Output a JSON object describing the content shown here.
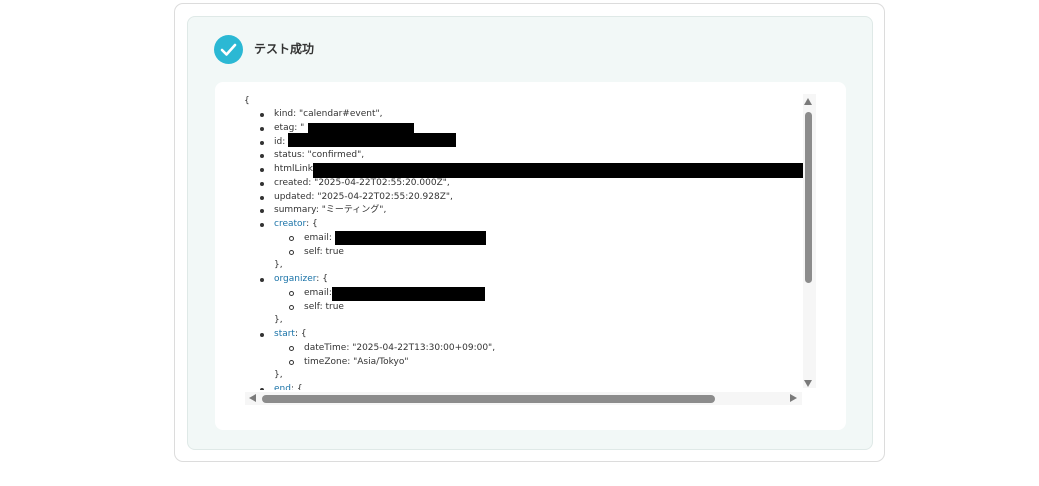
{
  "header": {
    "status_title": "テスト成功",
    "status_icon": "check-circle-icon",
    "accent_color": "#2bb8d4"
  },
  "json_view": {
    "open_brace": "{",
    "lines": {
      "kind": "kind: \"calendar#event\",",
      "etag": "etag: \"",
      "id": "id:",
      "status": "status: \"confirmed\",",
      "htmllink": "htmlLink",
      "created": "created: \"2025-04-22T02:55:20.000Z\",",
      "updated": "updated: \"2025-04-22T02:55:20.928Z\",",
      "summary": "summary: \"ミーティング\",",
      "creator_key": "creator",
      "creator_open": ": {",
      "creator_email": "email:",
      "creator_self": "self: true",
      "creator_close": "},",
      "organizer_key": "organizer",
      "organizer_open": ": {",
      "organizer_email": "email:",
      "organizer_self": "self: true",
      "organizer_close": "},",
      "start_key": "start",
      "start_open": ": {",
      "start_datetime": "dateTime: \"2025-04-22T13:30:00+09:00\",",
      "start_timezone": "timeZone: \"Asia/Tokyo\"",
      "start_close": "},",
      "end_key": "end",
      "end_open": ": {"
    },
    "link_color": "#1a73a8"
  }
}
